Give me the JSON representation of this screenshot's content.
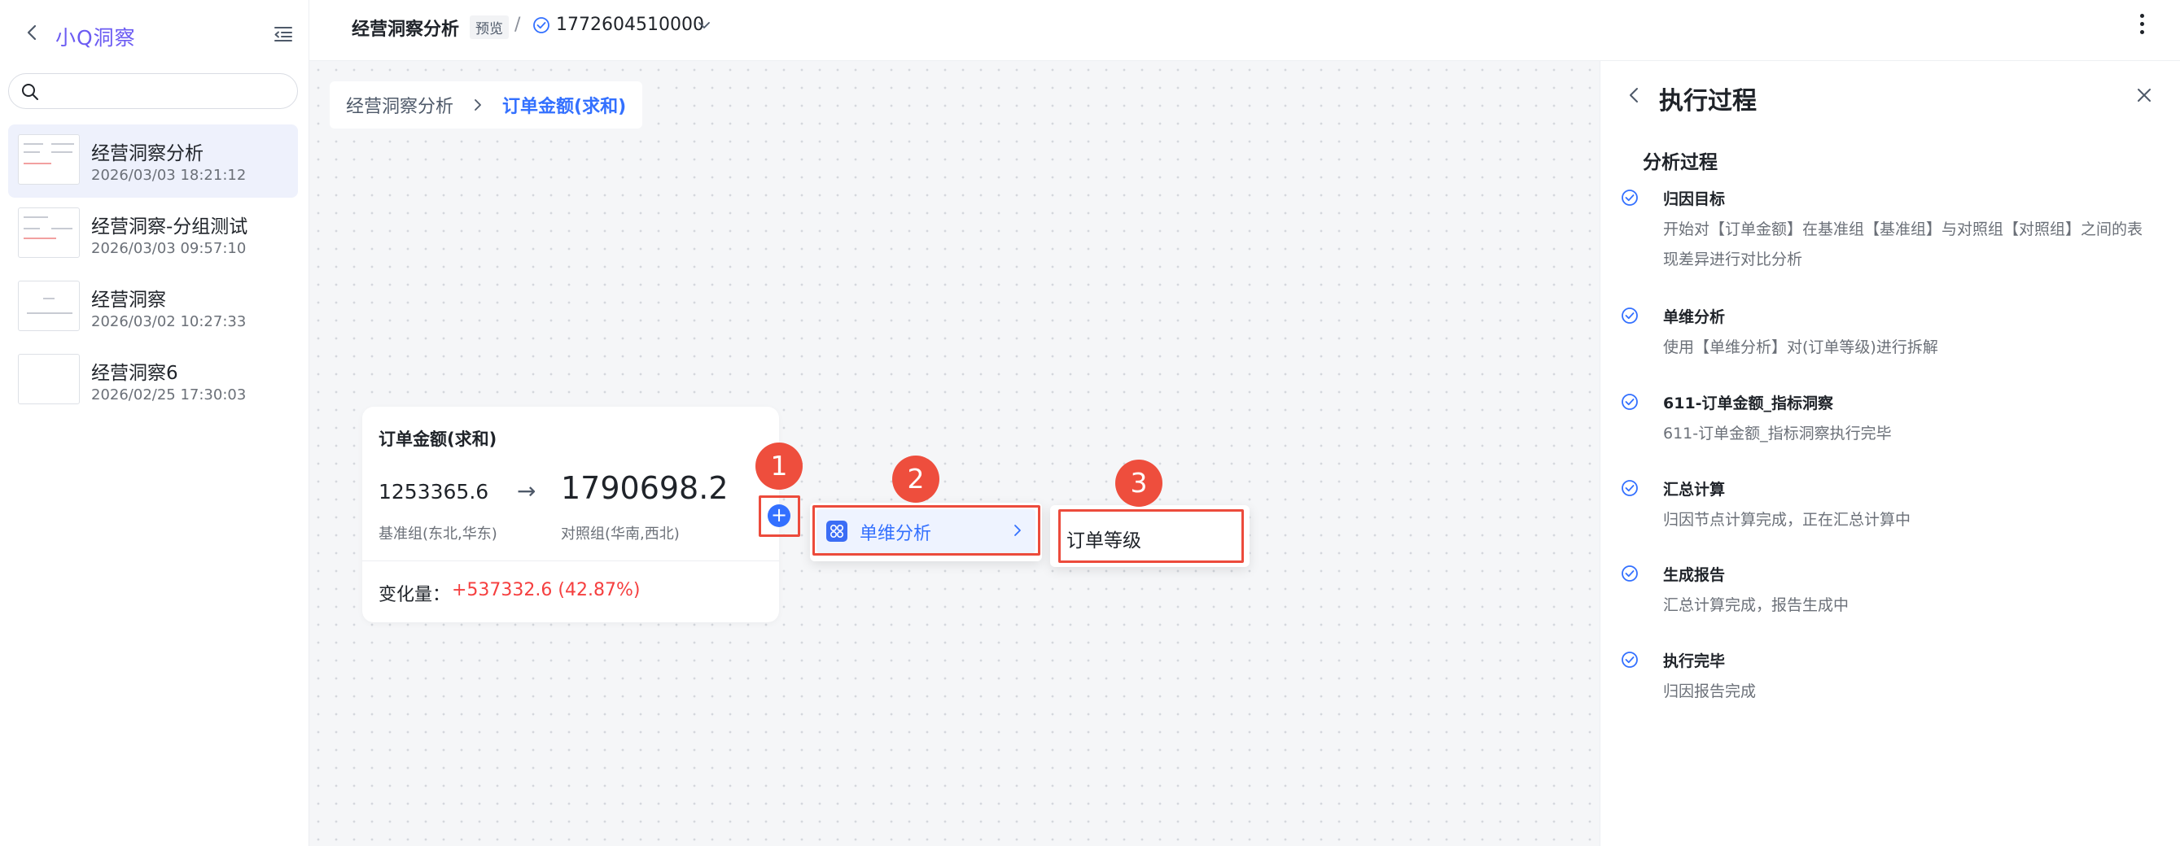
{
  "sidebar": {
    "app_name": "小Q洞察",
    "search": {
      "placeholder": "",
      "value": ""
    },
    "sessions": [
      {
        "title": "经营洞察分析",
        "date": "2026/03/03 18:21:12",
        "active": true
      },
      {
        "title": "经营洞察-分组测试",
        "date": "2026/03/03 09:57:10",
        "active": false
      },
      {
        "title": "经营洞察",
        "date": "2026/03/02 10:27:33",
        "active": false
      },
      {
        "title": "经营洞察6",
        "date": "2026/02/25 17:30:03",
        "active": false
      }
    ]
  },
  "topbar": {
    "title": "经营洞察分析",
    "badge": "预览",
    "separator": "/",
    "version": "1772604510000"
  },
  "canvas": {
    "breadcrumb": {
      "root": "经营洞察分析",
      "current": "订单金额(求和)"
    },
    "node": {
      "title": "订单金额(求和)",
      "base_value": "1253365.6",
      "arrow": "→",
      "compare_value": "1790698.2",
      "base_label": "基准组(东北,华东)",
      "compare_label": "对照组(华南,西北)",
      "change_label": "变化量：",
      "change_value": "+537332.6 (42.87%)"
    },
    "add_button": "+",
    "menu": {
      "item_label": "单维分析"
    },
    "submenu": {
      "item_label": "订单等级"
    },
    "markers": [
      "1",
      "2",
      "3"
    ]
  },
  "panel": {
    "title": "执行过程",
    "subtitle": "分析过程",
    "steps": [
      {
        "title": "归因目标",
        "desc": "开始对【订单金额】在基准组【基准组】与对照组【对照组】之间的表现差异进行对比分析"
      },
      {
        "title": "单维分析",
        "desc": "使用【单维分析】对(订单等级)进行拆解"
      },
      {
        "title": "611-订单金额_指标洞察",
        "desc": "611-订单金额_指标洞察执行完毕"
      },
      {
        "title": "汇总计算",
        "desc": "归因节点计算完成，正在汇总计算中"
      },
      {
        "title": "生成报告",
        "desc": "汇总计算完成，报告生成中"
      },
      {
        "title": "执行完毕",
        "desc": "归因报告完成"
      }
    ]
  },
  "colors": {
    "accent": "#3370ff",
    "brand": "#6b5bf2",
    "highlight": "#ec4b3c",
    "increase": "#f53f3f"
  }
}
